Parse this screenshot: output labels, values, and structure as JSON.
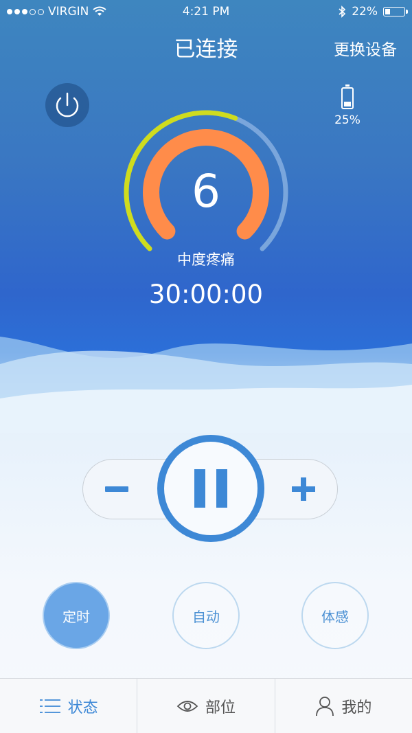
{
  "status_bar": {
    "carrier": "VIRGIN",
    "time": "4:21 PM",
    "battery_percent": "22%",
    "signal_bars": 3,
    "signal_total": 5,
    "battery_level": 0.22
  },
  "header": {
    "title": "已连接",
    "change_device": "更换设备"
  },
  "device": {
    "battery_label": "25%",
    "battery_level": 0.25
  },
  "gauge": {
    "level": "6",
    "pain_label": "中度疼痛",
    "timer": "30:00:00",
    "outer_progress": 0.58,
    "colors": {
      "outer_active": "#cfdc1e",
      "outer_track": "#7aa6dc",
      "inner": "#ff8c4a"
    }
  },
  "controls": {
    "minus": "minus-icon",
    "plus": "plus-icon",
    "pause": "pause-icon"
  },
  "modes": [
    {
      "label": "定时",
      "active": true
    },
    {
      "label": "自动",
      "active": false
    },
    {
      "label": "体感",
      "active": false
    }
  ],
  "tabs": [
    {
      "label": "状态",
      "icon": "list-icon",
      "active": true
    },
    {
      "label": "部位",
      "icon": "eye-icon",
      "active": false
    },
    {
      "label": "我的",
      "icon": "user-icon",
      "active": false
    }
  ],
  "accent": "#3d88d6"
}
